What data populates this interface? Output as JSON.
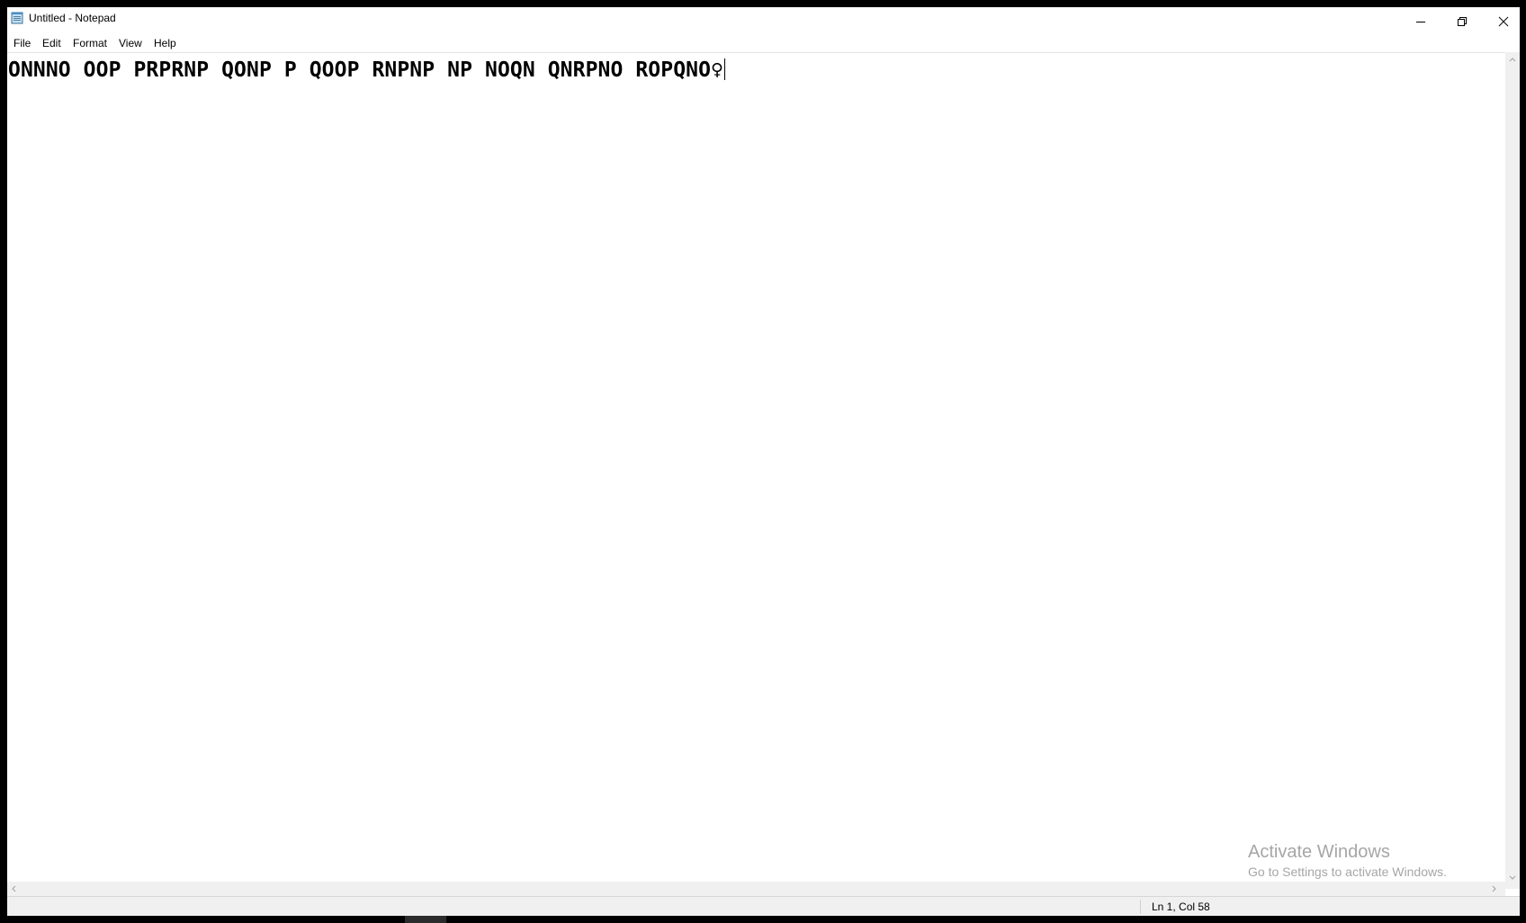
{
  "window": {
    "title": "Untitled - Notepad"
  },
  "menu": {
    "items": [
      "File",
      "Edit",
      "Format",
      "View",
      "Help"
    ]
  },
  "editor": {
    "content": "ONNNO OOP PRPRNP QONP P QOOP RNPNP NP NOQN QNRPNO ROPQNO♀"
  },
  "status": {
    "position": "Ln 1, Col 58"
  },
  "watermark": {
    "title": "Activate Windows",
    "subtitle": "Go to Settings to activate Windows."
  },
  "icons": {
    "app": "notepad-icon",
    "minimize": "minimize-icon",
    "maximize": "restore-icon",
    "close": "close-icon"
  },
  "colors": {
    "background": "#ffffff",
    "chrome": "#f0f0f0",
    "desktop": "#000000",
    "watermark": "#a6a6a6"
  }
}
